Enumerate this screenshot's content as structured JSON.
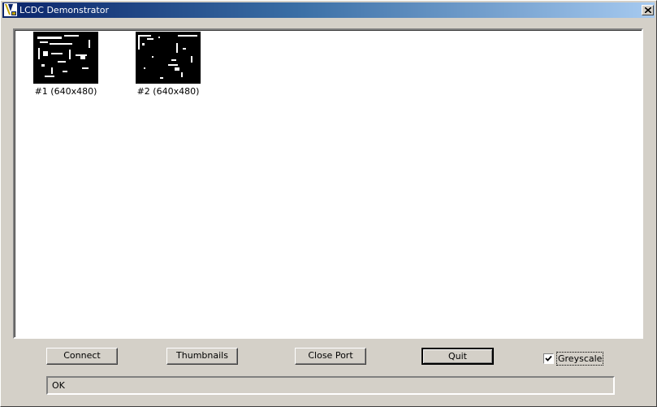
{
  "window": {
    "title": "LCDC Demonstrator"
  },
  "thumbnails": [
    {
      "label": "#1 (640x480)"
    },
    {
      "label": "#2 (640x480)"
    }
  ],
  "buttons": {
    "connect": "Connect",
    "thumbnails": "Thumbnails",
    "close_port": "Close Port",
    "quit": "Quit"
  },
  "greyscale": {
    "label": "Greyscale",
    "checked": true
  },
  "status": {
    "text": "OK"
  },
  "icons": {
    "app": "lcdc-app-icon",
    "close": "close-icon",
    "check": "checkmark-icon"
  },
  "colors": {
    "titlebar_start": "#0a246a",
    "titlebar_end": "#a6caf0",
    "face": "#d4d0c8"
  }
}
